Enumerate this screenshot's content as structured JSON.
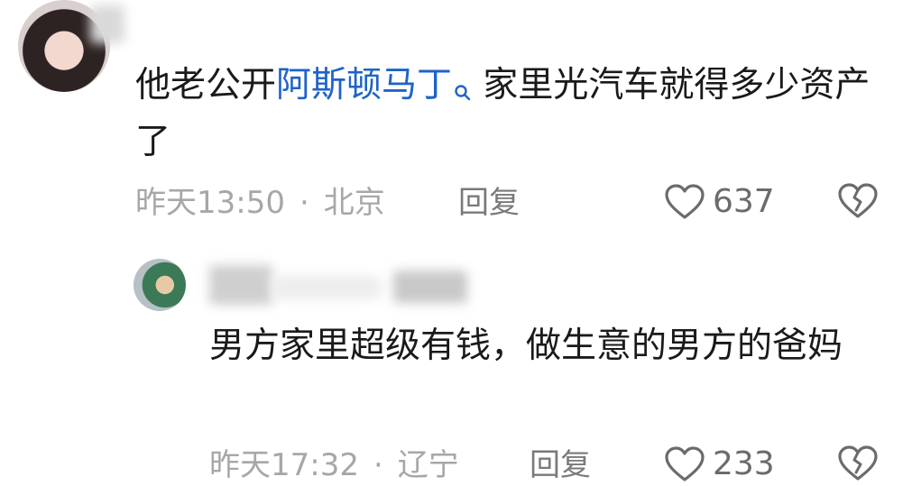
{
  "comment": {
    "text_before": "他老公开",
    "link_text": "阿斯顿马丁",
    "text_after": " 家里光汽车就得多少资产了",
    "time": "昨天13:50",
    "location": "北京",
    "reply_label": "回复",
    "likes": "637"
  },
  "reply": {
    "text": "男方家里超级有钱，做生意的男方的爸妈",
    "time": "昨天17:32",
    "location": "辽宁",
    "reply_label": "回复",
    "likes": "233"
  },
  "icons": [
    "heart-icon",
    "broken-heart-icon",
    "search-icon"
  ],
  "colors": {
    "link": "#1e63c8",
    "meta": "#a7a7a7",
    "text": "#1a1a1a"
  }
}
